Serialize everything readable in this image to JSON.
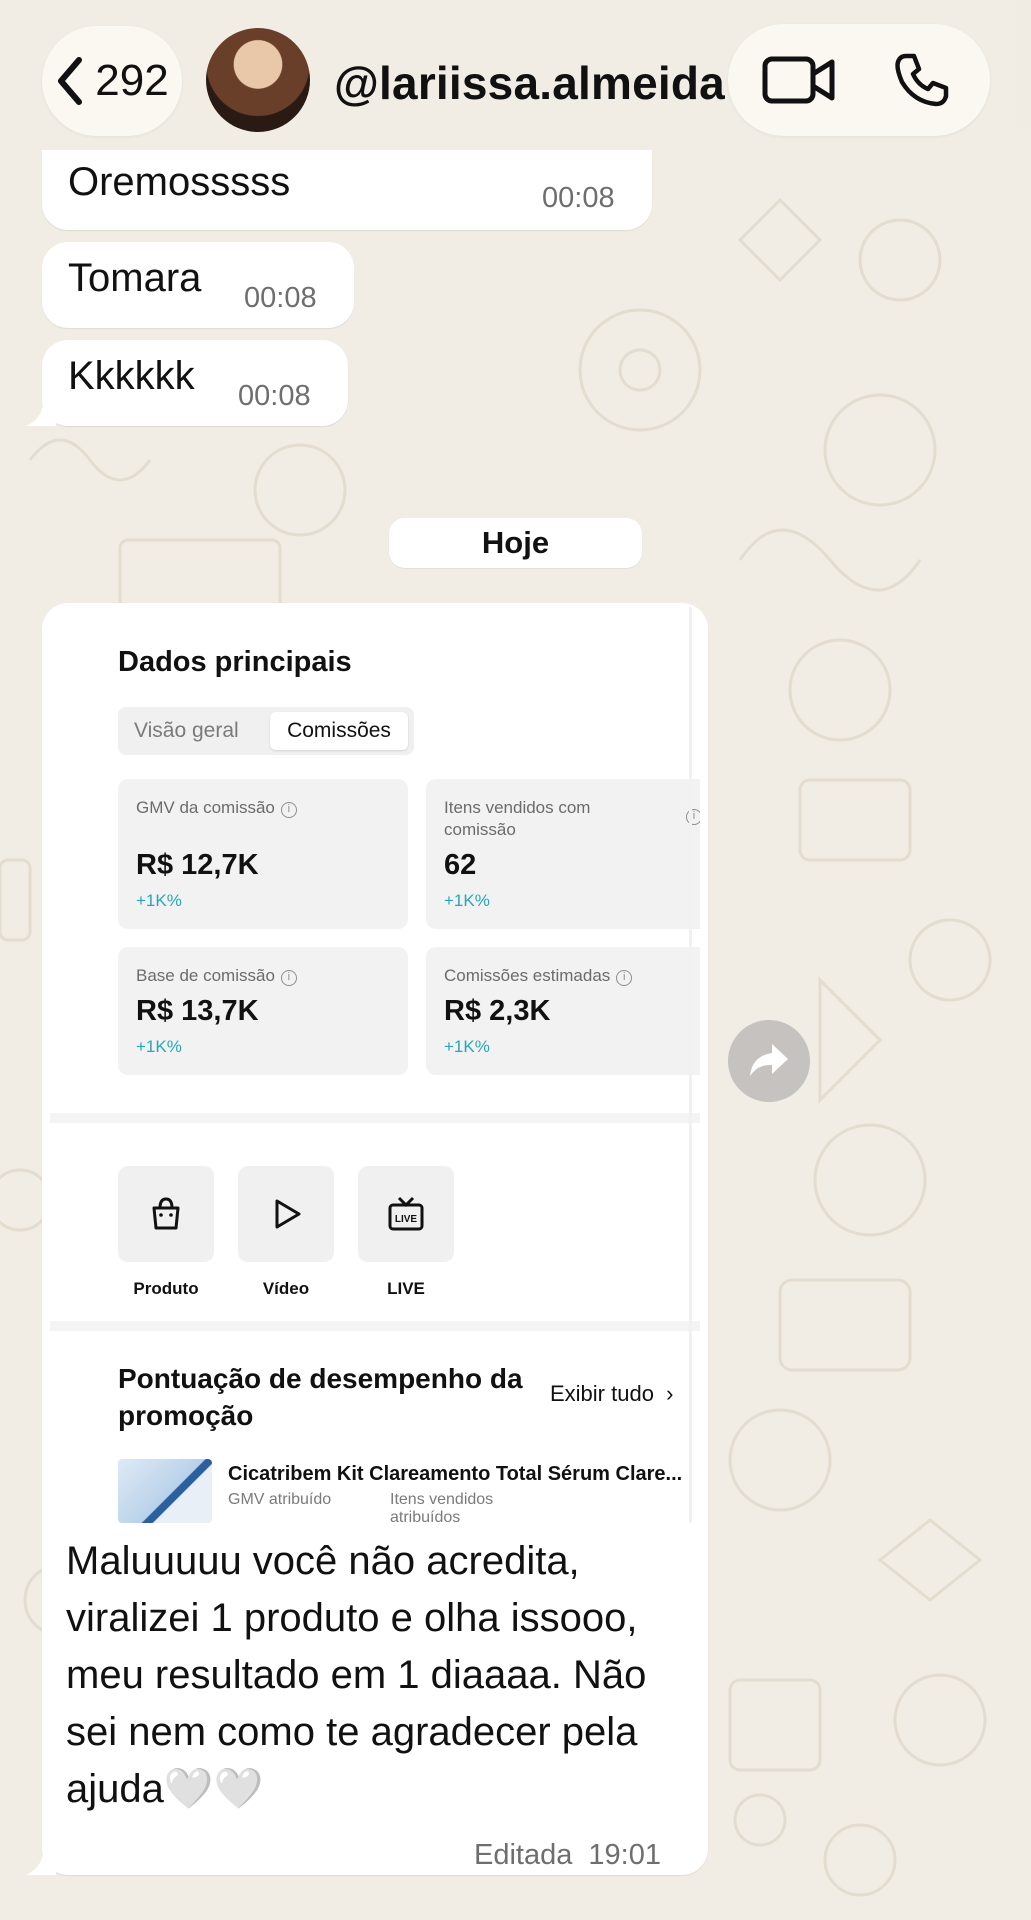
{
  "header": {
    "unread_count": "292",
    "contact_name": "@lariissa.almeida",
    "icons": {
      "back": "chevron-left-icon",
      "video": "video-camera-icon",
      "phone": "phone-icon"
    }
  },
  "messages": [
    {
      "text": "Oremosssss",
      "time": "00:08"
    },
    {
      "text": "Tomara",
      "time": "00:08"
    },
    {
      "text": "Kkkkkk",
      "time": "00:08"
    }
  ],
  "date_separator": "Hoje",
  "image_message": {
    "screenshot": {
      "title": "Dados principais",
      "tabs": [
        "Visão geral",
        "Comissões"
      ],
      "active_tab": "Comissões",
      "metrics": [
        {
          "label": "GMV da comissão",
          "value": "R$ 12,7K",
          "delta": "+1K%"
        },
        {
          "label": "Itens vendidos com comissão",
          "value": "62",
          "delta": "+1K%"
        },
        {
          "label": "Base de comissão",
          "value": "R$ 13,7K",
          "delta": "+1K%"
        },
        {
          "label": "Comissões estimadas",
          "value": "R$ 2,3K",
          "delta": "+1K%"
        }
      ],
      "shortcuts": [
        {
          "label": "Produto",
          "icon": "shopping-bag-icon"
        },
        {
          "label": "Vídeo",
          "icon": "play-icon"
        },
        {
          "label": "LIVE",
          "icon": "live-tv-icon"
        }
      ],
      "performance_title": "Pontuação de desempenho da promoção",
      "see_all": "Exibir tudo",
      "product": {
        "name": "Cicatribem Kit Clareamento Total Sérum Clare...",
        "col1": "GMV atribuído",
        "col2": "Itens vendidos atribuídos"
      }
    },
    "caption": "Maluuuuu você não acredita, viralizei 1 produto e olha issooo, meu resultado em 1 diaaaa. Não sei nem como te agradecer pela ajuda🤍🤍",
    "edited_label": "Editada",
    "time": "19:01"
  },
  "colors": {
    "background": "#f1ece4",
    "bubble": "#ffffff",
    "delta_teal": "#2aa6b8"
  }
}
